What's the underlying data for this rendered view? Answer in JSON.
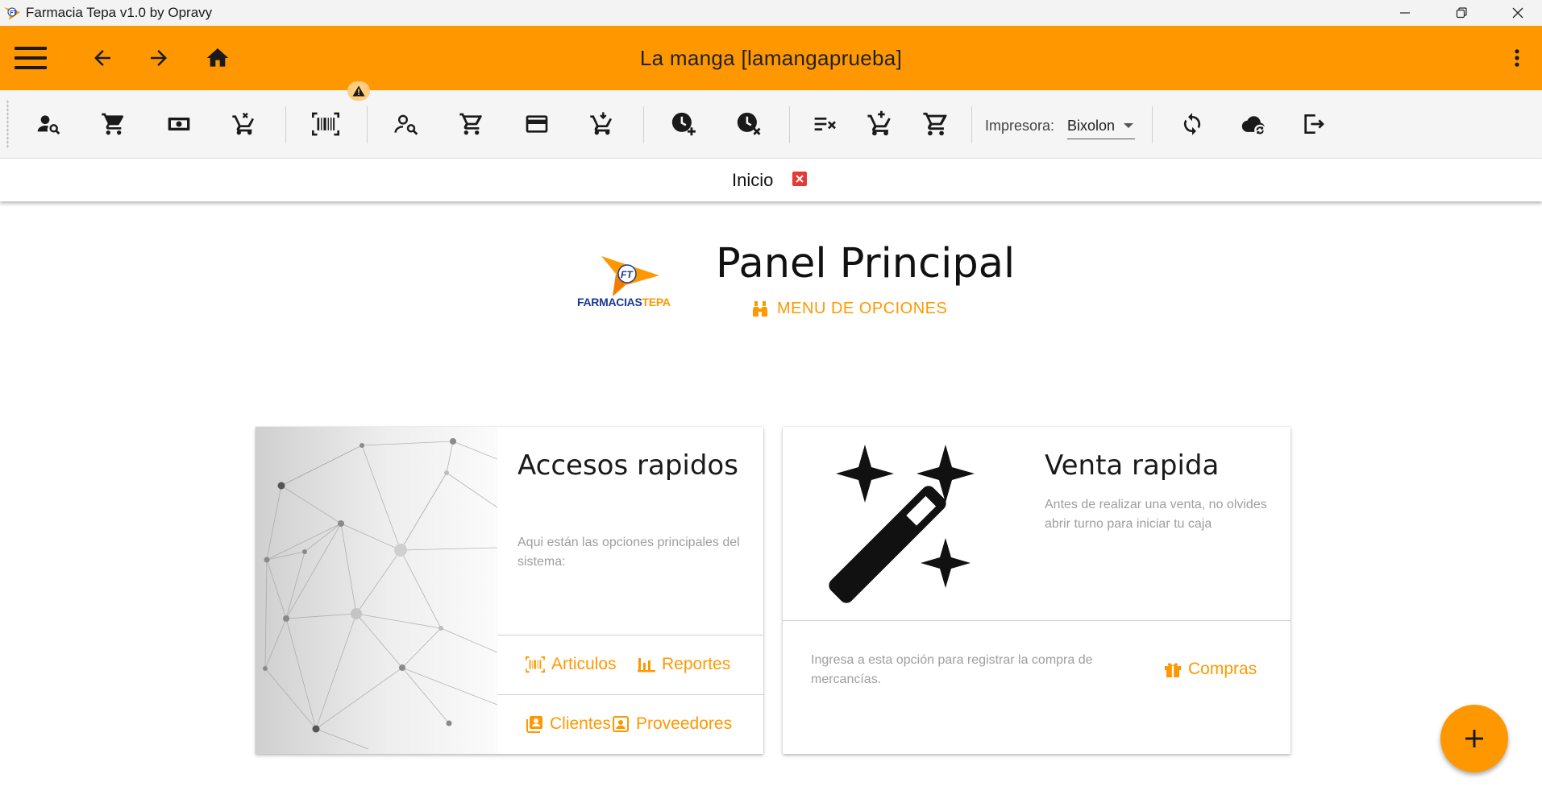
{
  "window": {
    "title": "Farmacia Tepa v1.0 by Opravy",
    "controls": [
      "minimize-icon",
      "restore-icon",
      "close-icon"
    ]
  },
  "appbar": {
    "title": "La manga [lamangaprueba]",
    "left_icons": [
      "menu-icon",
      "arrow-back-icon",
      "arrow-forward-icon",
      "home-icon"
    ],
    "right_icon": "more-vert-icon",
    "color": "#ff9800"
  },
  "toolbar": {
    "groups": [
      [
        "user-search-icon",
        "cart-icon",
        "cash-icon",
        "cart-remove-icon"
      ],
      [
        "barcode-scan-icon"
      ],
      [
        "user-search-icon",
        "cart-icon",
        "credit-card-icon",
        "cart-arrow-down-icon"
      ],
      [
        "clock-add-icon",
        "clock-cancel-icon"
      ],
      [
        "list-cancel-icon",
        "cart-plus-icon",
        "cart-check-icon"
      ],
      [
        "sync-icon",
        "cloud-sync-icon",
        "logout-icon"
      ]
    ],
    "warning_icon": "warning-icon",
    "printer_label": "Impresora:",
    "printer_value": "Bixolon"
  },
  "tabs": [
    {
      "label": "Inicio",
      "closable": true
    }
  ],
  "header": {
    "brand_text_a": "FARMACIAS",
    "brand_text_b": "TEPA",
    "logo_initials": "FT",
    "title": "Panel Principal",
    "menu_link": "MENU DE OPCIONES"
  },
  "cards": {
    "quick_access": {
      "title": "Accesos rapidos",
      "description": "Aqui están las opciones principales del sistema:",
      "actions": [
        {
          "label": "Articulos",
          "icon": "barcode-icon"
        },
        {
          "label": "Reportes",
          "icon": "bar-chart-icon"
        },
        {
          "label": "Clientes",
          "icon": "contacts-icon"
        },
        {
          "label": "Proveedores",
          "icon": "contact-card-icon"
        }
      ]
    },
    "quick_sale": {
      "title": "Venta rapida",
      "description": "Antes de realizar una venta, no olvides abrir turno para iniciar tu caja",
      "purchase_text": "Ingresa a esta opción para registrar la compra de mercancías.",
      "purchase_action": "Compras",
      "purchase_icon": "gift-icon",
      "illustration_icon": "magic-wand-icon"
    }
  },
  "fab": {
    "icon": "plus-icon"
  },
  "colors": {
    "accent": "#ff9800",
    "danger": "#e53935",
    "toolbar_bg": "#f5f5f5"
  }
}
